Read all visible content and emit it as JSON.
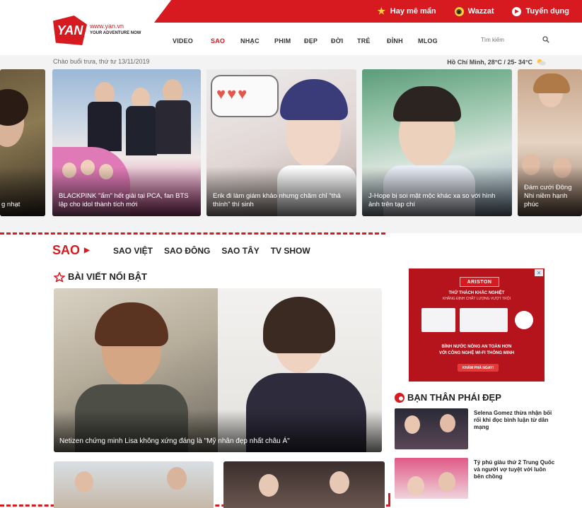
{
  "header": {
    "top_links": [
      {
        "label": "Hay mê mẩn",
        "icon": "star-icon"
      },
      {
        "label": "Wazzat",
        "icon": "wazzat-icon"
      },
      {
        "label": "Tuyển dụng",
        "icon": "play-circle-icon"
      }
    ],
    "logo": {
      "mark": "YAN",
      "url": "www.yan.vn",
      "tagline": "YOUR ADVENTURE NOW"
    },
    "nav": [
      "VIDEO",
      "SAO",
      "NHẠC",
      "PHIM",
      "ĐẸP",
      "ĐỜI",
      "TRẺ",
      "ĐỈNH",
      "MLOG"
    ],
    "nav_active": "SAO",
    "search": {
      "placeholder": "Tìm kiếm"
    }
  },
  "greeting": "Chào buổi trưa, thứ tư 13/11/2019",
  "weather": "Hồ Chí Minh, 28°C / 25- 34°C",
  "carousel": [
    {
      "caption": "g nhạt"
    },
    {
      "caption": "BLACKPINK \"ẩm\" hết giải tại PCA, fan BTS lập cho idol thành tích mới"
    },
    {
      "caption": "Erik đi làm giám khảo nhưng chăm chỉ \"thả thính\" thí sinh"
    },
    {
      "caption": "J-Hope bị soi mặt mộc khác xa so với hình ảnh trên tạp chí"
    },
    {
      "caption": "Đám cưới Đông Nhi niềm hạnh phúc"
    }
  ],
  "section": {
    "title": "SAO",
    "subnav": [
      "SAO VIỆT",
      "SAO ĐÔNG",
      "SAO TÂY",
      "TV SHOW"
    ],
    "featured_heading": "BÀI VIẾT NỔI BẬT",
    "featured_caption": "Netizen chứng minh Lisa không xứng đáng là \"Mỹ nhân đẹp nhất châu Á\""
  },
  "ad": {
    "brand": "ARISTON",
    "line1": "THỬ THÁCH KHẮC NGHIỆT",
    "line2": "KHẲNG ĐỊNH CHẤT LƯỢNG VƯỢT TRỘI",
    "line3": "BÌNH NƯỚC NÓNG AN TOÀN HƠN",
    "line4": "VỚI CÔNG NGHỆ WI-FI THÔNG MINH",
    "cta": "KHÁM PHÁ NGAY!"
  },
  "sidebar": {
    "heading": "BẠN THÂN PHÁI ĐẸP",
    "items": [
      {
        "title": "Selena Gomez thừa nhận bối rối khi đọc bình luận từ dân mạng"
      },
      {
        "title": "Tỷ phú giàu thứ 2 Trung Quốc và người vợ tuyệt với luôn bên chồng"
      }
    ]
  },
  "colors": {
    "brand_red": "#d71920",
    "ad_red": "#b5141c"
  }
}
